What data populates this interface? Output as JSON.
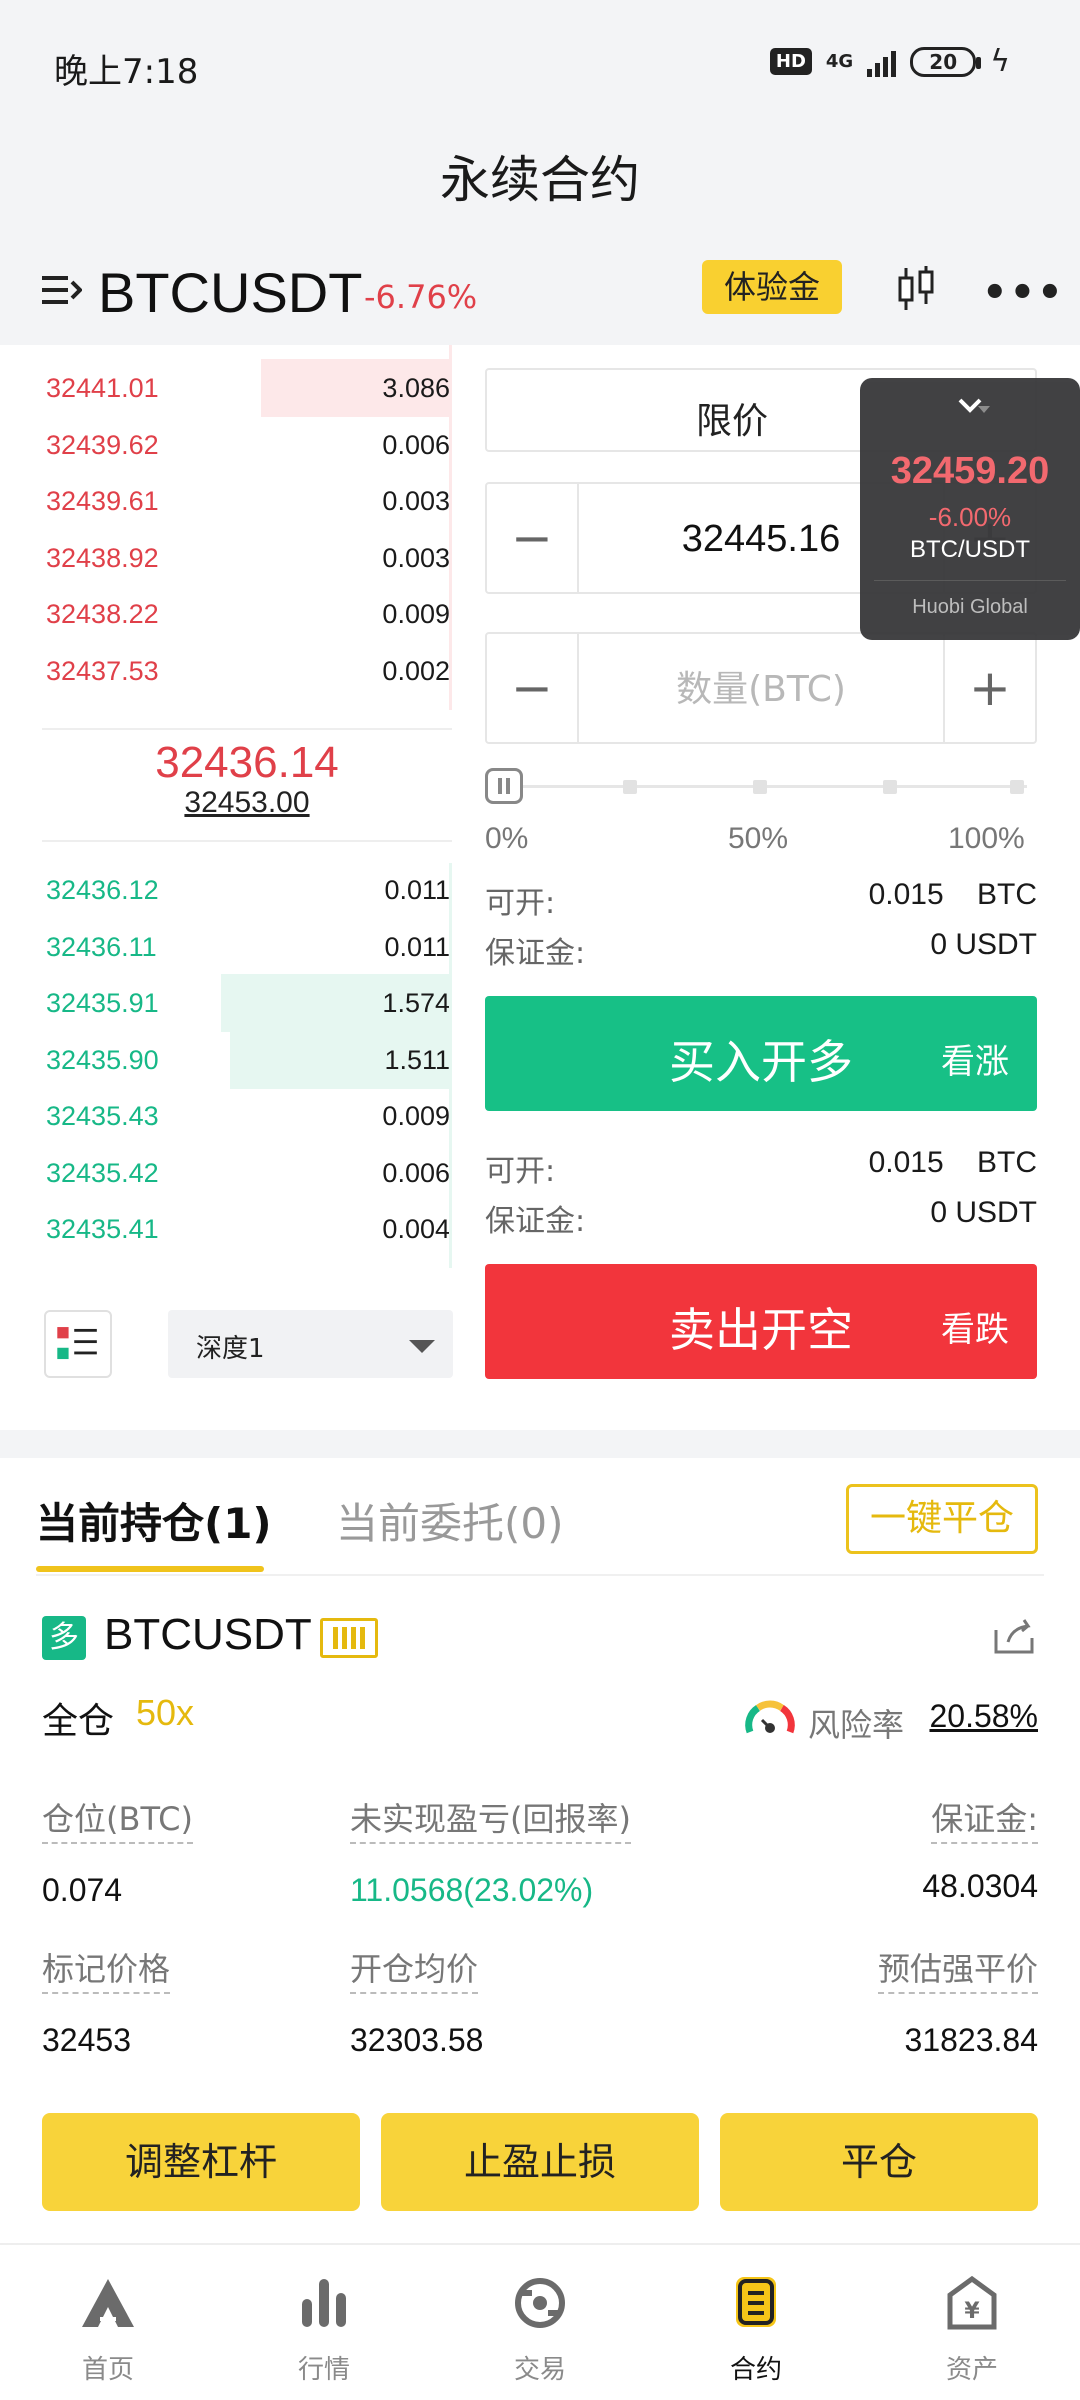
{
  "status_bar": {
    "time": "晚上7:18",
    "hd": "HD",
    "network": "4G",
    "battery": "20"
  },
  "page_title": "永续合约",
  "symbol_bar": {
    "symbol": "BTCUSDT",
    "change": "-6.76%",
    "trial_badge": "体验金"
  },
  "order_book": {
    "asks": [
      {
        "price": "32441.01",
        "qty": "3.086",
        "depth": 0.42
      },
      {
        "price": "32439.62",
        "qty": "0.006",
        "depth": 0
      },
      {
        "price": "32439.61",
        "qty": "0.003",
        "depth": 0
      },
      {
        "price": "32438.92",
        "qty": "0.003",
        "depth": 0
      },
      {
        "price": "32438.22",
        "qty": "0.009",
        "depth": 0
      },
      {
        "price": "32437.53",
        "qty": "0.002",
        "depth": 0
      }
    ],
    "last_price": "32436.14",
    "mark_price": "32453.00",
    "bids": [
      {
        "price": "32436.12",
        "qty": "0.011",
        "depth": 0
      },
      {
        "price": "32436.11",
        "qty": "0.011",
        "depth": 0
      },
      {
        "price": "32435.91",
        "qty": "1.574",
        "depth": 0.51
      },
      {
        "price": "32435.90",
        "qty": "1.511",
        "depth": 0.49
      },
      {
        "price": "32435.43",
        "qty": "0.009",
        "depth": 0
      },
      {
        "price": "32435.42",
        "qty": "0.006",
        "depth": 0
      },
      {
        "price": "32435.41",
        "qty": "0.004",
        "depth": 0
      }
    ],
    "depth_select": "深度1"
  },
  "order_form": {
    "order_type": "限价",
    "price_value": "32445.16",
    "qty_placeholder": "数量(BTC)",
    "minus": "−",
    "plus": "+",
    "slider_value": 0,
    "pct_labels": [
      "0%",
      "50%",
      "100%"
    ],
    "buy_info": {
      "available_label": "可开:",
      "available_value": "0.015    BTC",
      "margin_label": "保证金:",
      "margin_value": "0 USDT"
    },
    "sell_info": {
      "available_label": "可开:",
      "available_value": "0.015    BTC",
      "margin_label": "保证金:",
      "margin_value": "0 USDT"
    },
    "buy_button": {
      "label": "买入开多",
      "sub": "看涨"
    },
    "sell_button": {
      "label": "卖出开空",
      "sub": "看跌"
    }
  },
  "float_ticker": {
    "price": "32459.20",
    "change": "-6.00%",
    "pair": "BTC/USDT",
    "brand": "Huobi Global"
  },
  "positions": {
    "tabs": [
      "当前持仓(1)",
      "当前委托(0)"
    ],
    "close_all": "一键平仓",
    "position": {
      "side_badge": "多",
      "symbol": "BTCUSDT",
      "margin_mode": "全仓",
      "leverage": "50x",
      "risk_label": "风险率",
      "risk_value": "20.58%",
      "fields": {
        "size_label": "仓位(BTC)",
        "size_value": "0.074",
        "pnl_label": "未实现盈亏(回报率)",
        "pnl_value": "11.0568(23.02%)",
        "margin_label": "保证金:",
        "margin_value": "48.0304",
        "mark_label": "标记价格",
        "mark_value": "32453",
        "entry_label": "开仓均价",
        "entry_value": "32303.58",
        "liq_label": "预估强平价",
        "liq_value": "31823.84"
      }
    },
    "buttons": [
      "调整杠杆",
      "止盈止损",
      "平仓"
    ]
  },
  "bottom_nav": {
    "items": [
      {
        "label": "首页",
        "icon": "home-icon"
      },
      {
        "label": "行情",
        "icon": "market-icon"
      },
      {
        "label": "交易",
        "icon": "trade-icon"
      },
      {
        "label": "合约",
        "icon": "contract-icon"
      },
      {
        "label": "资产",
        "icon": "assets-icon"
      }
    ],
    "active": "合约"
  },
  "colors": {
    "up": "#17b887",
    "down": "#e04049",
    "accent": "#f8d33a"
  }
}
